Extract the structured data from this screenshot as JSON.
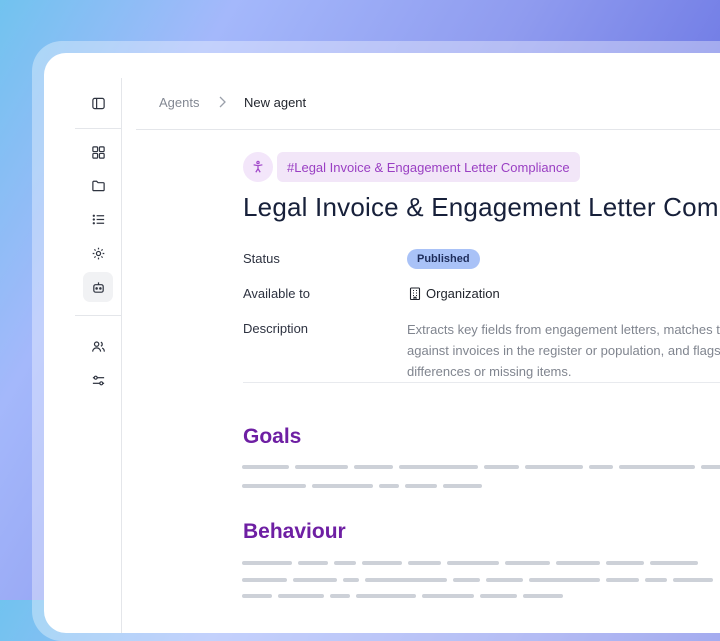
{
  "breadcrumb": {
    "parent": "Agents",
    "current": "New agent"
  },
  "agent": {
    "tag": "#Legal Invoice & Engagement Letter Compliance",
    "title": "Legal Invoice & Engagement Letter Compliance",
    "fields": {
      "status_label": "Status",
      "status_value": "Published",
      "available_label": "Available to",
      "available_value": "Organization",
      "description_label": "Description",
      "description_value": "Extracts key fields from engagement letters, matches them against invoices in the register or population, and flags differences or missing items."
    }
  },
  "sections": {
    "goals": "Goals",
    "behaviour": "Behaviour"
  },
  "icons": {
    "rail": [
      "sidebar-toggle-icon",
      "dashboard-grid-icon",
      "folder-icon",
      "list-icon",
      "settings-gear-icon",
      "agent-bot-icon",
      "users-icon",
      "sliders-icon"
    ],
    "tag": "accessibility-figure-icon",
    "available": "building-icon"
  },
  "colors": {
    "accent": "#6e1fa3",
    "tag": "#9a3fc3",
    "status": "#a9c2f7"
  }
}
